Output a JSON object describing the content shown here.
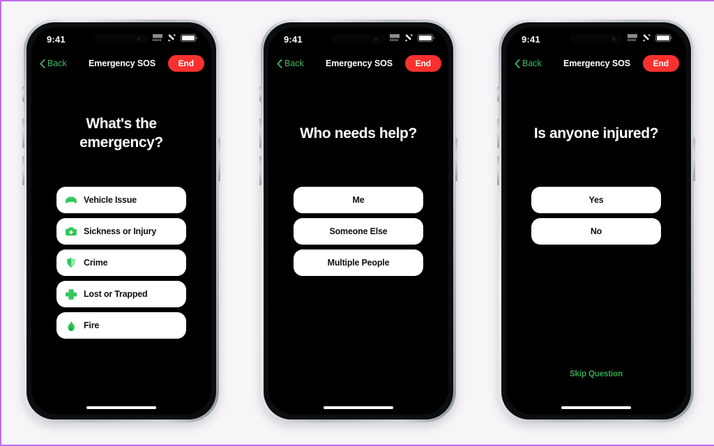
{
  "page": {
    "background_color": "#f7f5f8",
    "border_color": "#c06ef0",
    "accent_green": "#32c759",
    "accent_red": "#f8312f"
  },
  "status_bar": {
    "time": "9:41",
    "icons": [
      "cellular-sos-icon",
      "satellite-icon",
      "battery-icon"
    ]
  },
  "nav": {
    "back_label": "Back",
    "title": "Emergency SOS",
    "end_label": "End"
  },
  "screens": [
    {
      "id": "screen-what-emergency",
      "question": "What's the emergency?",
      "question_lines": [
        "What's the",
        "emergency?"
      ],
      "layout": "icon-list",
      "options": [
        {
          "label": "Vehicle Issue",
          "icon": "car-icon"
        },
        {
          "label": "Sickness or Injury",
          "icon": "medical-kit-icon"
        },
        {
          "label": "Crime",
          "icon": "shield-icon"
        },
        {
          "label": "Lost or Trapped",
          "icon": "cross-icon"
        },
        {
          "label": "Fire",
          "icon": "flame-icon"
        }
      ],
      "skip_label": null
    },
    {
      "id": "screen-who-needs-help",
      "question": "Who needs help?",
      "question_lines": [
        "Who needs help?"
      ],
      "layout": "centered-list",
      "options": [
        {
          "label": "Me",
          "icon": null
        },
        {
          "label": "Someone Else",
          "icon": null
        },
        {
          "label": "Multiple People",
          "icon": null
        }
      ],
      "skip_label": null
    },
    {
      "id": "screen-is-anyone-injured",
      "question": "Is anyone injured?",
      "question_lines": [
        "Is anyone injured?"
      ],
      "layout": "centered-list",
      "options": [
        {
          "label": "Yes",
          "icon": null
        },
        {
          "label": "No",
          "icon": null
        }
      ],
      "skip_label": "Skip Question"
    }
  ]
}
